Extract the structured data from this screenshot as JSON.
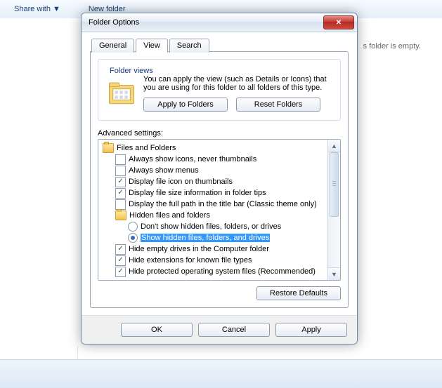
{
  "bg": {
    "share": "Share with ▼",
    "newfolder": "New folder",
    "empty": "s folder is empty."
  },
  "dialog": {
    "title": "Folder Options",
    "tabs": {
      "general": "General",
      "view": "View",
      "search": "Search"
    },
    "folderviews": {
      "title": "Folder views",
      "text": "You can apply the view (such as Details or Icons) that you are using for this folder to all folders of this type.",
      "apply": "Apply to Folders",
      "reset": "Reset Folders"
    },
    "advanced_label": "Advanced settings:",
    "tree": {
      "root": "Files and Folders",
      "i1": "Always show icons, never thumbnails",
      "i2": "Always show menus",
      "i3": "Display file icon on thumbnails",
      "i4": "Display file size information in folder tips",
      "i5": "Display the full path in the title bar (Classic theme only)",
      "hidden": "Hidden files and folders",
      "r1": "Don't show hidden files, folders, or drives",
      "r2": "Show hidden files, folders, and drives",
      "i6": "Hide empty drives in the Computer folder",
      "i7": "Hide extensions for known file types",
      "i8": "Hide protected operating system files (Recommended)"
    },
    "restore": "Restore Defaults",
    "ok": "OK",
    "cancel": "Cancel",
    "apply": "Apply"
  }
}
